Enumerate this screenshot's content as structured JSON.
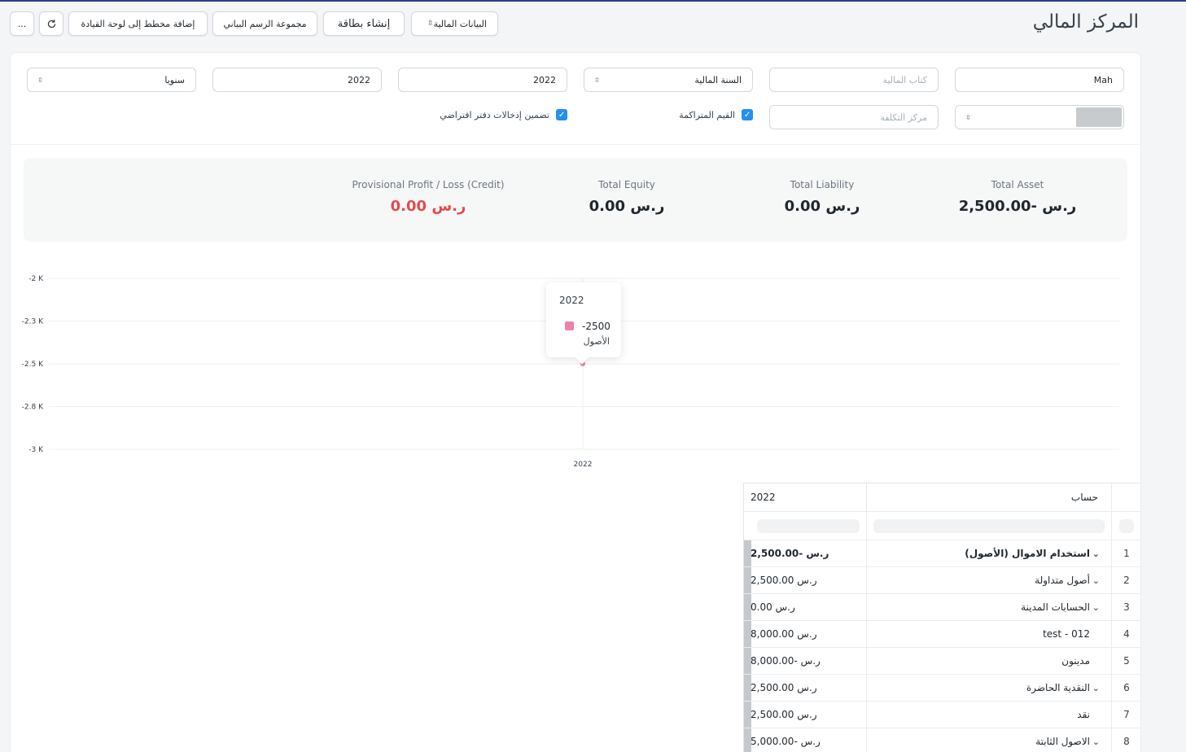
{
  "header": {
    "title": "المركز المالي",
    "buttons": {
      "financial_data": "البيانات المالية",
      "create_card": "إنشاء بطاقة",
      "chart_group": "مجموعة الرسم البياني",
      "add_to_dashboard": "إضافة مخطط إلى لوحة القيادة",
      "refresh_icon": "refresh-icon",
      "more": "..."
    }
  },
  "filters": {
    "company": "Mah",
    "finance_book": "كتاب المالية",
    "period_selection": "السنة المالية",
    "from_year": "2022",
    "to_year": "2022",
    "periodicity": "سنويا",
    "cost_center": "مركز التكلفة",
    "accumulated_values": "القيم المتراكمة",
    "include_default_book": "تضمين إدخالات دفتر افتراضي"
  },
  "summary": {
    "total_asset_label": "Total Asset",
    "total_asset_value": "ر.س -2,500.00",
    "total_liability_label": "Total Liability",
    "total_liability_value": "ر.س 0.00",
    "total_equity_label": "Total Equity",
    "total_equity_value": "ر.س 0.00",
    "profit_loss_label": "Provisional Profit / Loss (Credit)",
    "profit_loss_value": "ر.س 0.00",
    "red_color": "#e24c4c"
  },
  "chart_data": {
    "type": "line",
    "categories": [
      "2022"
    ],
    "series": [
      {
        "name": "الأصول",
        "values": [
          -2500
        ],
        "color": "#f081a5"
      }
    ],
    "y_ticks": [
      "-2 K",
      "-2.3 K",
      "-2.5 K",
      "-2.8 K",
      "-3 K"
    ],
    "ylim": [
      -3000,
      -2000
    ],
    "grid": true,
    "tooltip": {
      "title": "2022",
      "value": "-2500",
      "series": "الأصول"
    }
  },
  "table": {
    "headers": {
      "account": "حساب",
      "year": "2022"
    },
    "rows": [
      {
        "idx": "1",
        "account": "استخدام الاموال (الأصول)",
        "value": "ر.س -2,500.00",
        "bold": true,
        "group": true
      },
      {
        "idx": "2",
        "account": "أصول متداولة",
        "value": "ر.س 2,500.00",
        "bold": false,
        "group": true
      },
      {
        "idx": "3",
        "account": "الحسابات المدينة",
        "value": "ر.س 0.00",
        "bold": false,
        "group": true
      },
      {
        "idx": "4",
        "account": "012 - test",
        "value": "ر.س 8,000.00",
        "bold": false,
        "group": false
      },
      {
        "idx": "5",
        "account": "مدينون",
        "value": "ر.س -8,000.00",
        "bold": false,
        "group": false
      },
      {
        "idx": "6",
        "account": "النقدية الحاضرة",
        "value": "ر.س 2,500.00",
        "bold": false,
        "group": true
      },
      {
        "idx": "7",
        "account": "نقد",
        "value": "ر.س 2,500.00",
        "bold": false,
        "group": false
      },
      {
        "idx": "8",
        "account": "الاصول الثابتة",
        "value": "ر.س -5,000.00",
        "bold": false,
        "group": true
      }
    ]
  }
}
